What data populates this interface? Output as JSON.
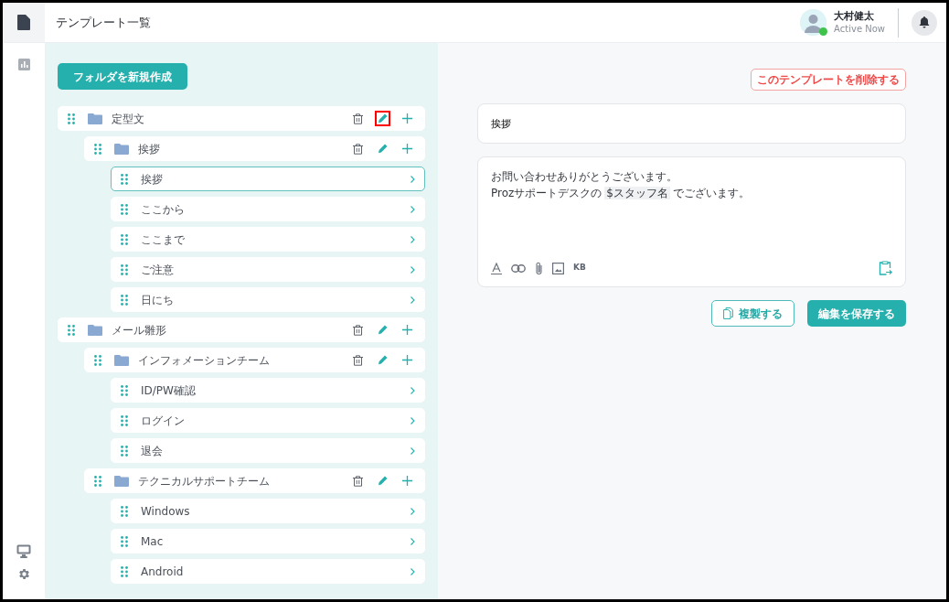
{
  "header": {
    "title": "テンプレート一覧",
    "user": {
      "name": "大村健太",
      "status": "Active Now",
      "online": true
    }
  },
  "sidebar": {
    "items": [
      {
        "selected": true
      },
      {
        "selected": false
      }
    ]
  },
  "tree_panel": {
    "new_folder_button": "フォルダを新規作成",
    "tree": [
      {
        "kind": "folder",
        "name": "定型文",
        "edit_highlighted": true,
        "children": [
          {
            "kind": "folder",
            "name": "挨拶",
            "edit_highlighted": false,
            "children": [
              {
                "kind": "template",
                "name": "挨拶",
                "selected": true
              },
              {
                "kind": "template",
                "name": "ここから",
                "selected": false
              },
              {
                "kind": "template",
                "name": "ここまで",
                "selected": false
              },
              {
                "kind": "template",
                "name": "ご注意",
                "selected": false
              },
              {
                "kind": "template",
                "name": "日にち",
                "selected": false
              }
            ]
          }
        ]
      },
      {
        "kind": "folder",
        "name": "メール雛形",
        "edit_highlighted": false,
        "children": [
          {
            "kind": "folder",
            "name": "インフォメーションチーム",
            "edit_highlighted": false,
            "children": [
              {
                "kind": "template",
                "name": "ID/PW確認",
                "selected": false
              },
              {
                "kind": "template",
                "name": "ログイン",
                "selected": false
              },
              {
                "kind": "template",
                "name": "退会",
                "selected": false
              }
            ]
          },
          {
            "kind": "folder",
            "name": "テクニカルサポートチーム",
            "edit_highlighted": false,
            "children": [
              {
                "kind": "template",
                "name": "Windows",
                "selected": false
              },
              {
                "kind": "template",
                "name": "Mac",
                "selected": false
              },
              {
                "kind": "template",
                "name": "Android",
                "selected": false
              }
            ]
          }
        ]
      }
    ]
  },
  "editor": {
    "delete_button": "このテンプレートを削除する",
    "title_value": "挨拶",
    "body": [
      [
        {
          "kind": "plain",
          "text": "お問い合わせありがとうございます。"
        }
      ],
      [
        {
          "kind": "plain",
          "text": "Prozサポートデスクの"
        },
        {
          "kind": "variable",
          "text": "$スタッフ名"
        },
        {
          "kind": "plain",
          "text": "でございます。"
        }
      ]
    ],
    "toolbar": [
      {
        "kind": "icon"
      },
      {
        "kind": "icon"
      },
      {
        "kind": "icon"
      },
      {
        "kind": "icon"
      },
      {
        "kind": "text",
        "text": "KB"
      }
    ],
    "duplicate_button": "複製する",
    "save_button": "編集を保存する"
  }
}
